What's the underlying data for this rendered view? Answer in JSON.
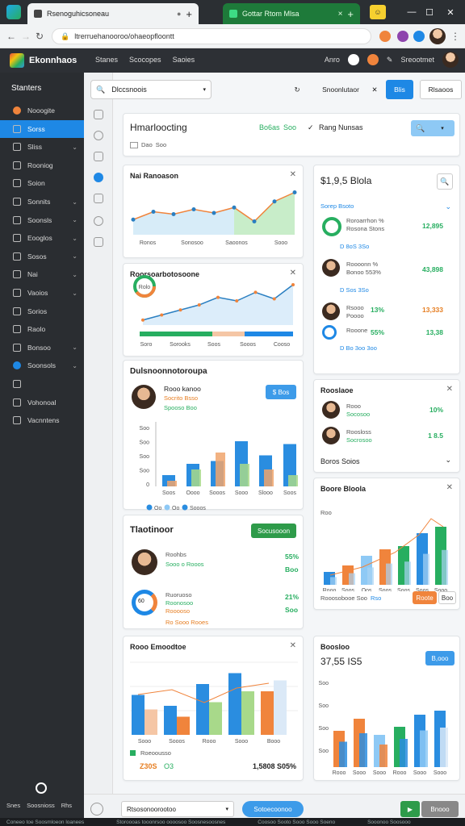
{
  "browser": {
    "tab1_title": "Rsenoguhicsoneau",
    "tab2_title": "Gottar Rtom Mlsa",
    "url": "ltrerruehanooroo/ohaeopfloontt",
    "win_controls": [
      "—",
      "☐",
      "✕"
    ]
  },
  "app": {
    "brand": "Ekonnhaos",
    "nav": [
      "Stanes",
      "Scocopes",
      "Saoies"
    ],
    "top_right": [
      "Anro",
      "Sreootmet"
    ]
  },
  "sidebar": {
    "title": "Stanters",
    "items": [
      {
        "label": "Nooogite",
        "chev": ""
      },
      {
        "label": "Sorss",
        "chev": ""
      },
      {
        "label": "Sliss",
        "chev": "⌄"
      },
      {
        "label": "Rooniog",
        "chev": ""
      },
      {
        "label": "Soion",
        "chev": ""
      },
      {
        "label": "Sonnits",
        "chev": "⌄"
      },
      {
        "label": "Soonsls",
        "chev": "⌄"
      },
      {
        "label": "Eooglos",
        "chev": "⌄"
      },
      {
        "label": "Sosos",
        "chev": "⌄"
      },
      {
        "label": "Nai",
        "chev": "⌄"
      },
      {
        "label": "Vaoios",
        "chev": "⌄"
      },
      {
        "label": "Sorios",
        "chev": ""
      },
      {
        "label": "Raolo",
        "chev": ""
      },
      {
        "label": "Bonsoo",
        "chev": "⌄"
      },
      {
        "label": "Soonsols",
        "chev": "⌄"
      },
      {
        "label": "",
        "chev": ""
      },
      {
        "label": "Vohonoal",
        "chev": ""
      },
      {
        "label": "Vacnntens",
        "chev": ""
      }
    ],
    "bottom": [
      "Snes",
      "Soosnioss",
      "Rhs"
    ]
  },
  "toolbar": {
    "search_text": "Dlccsnoois",
    "filter_label": "Snoonlutaor",
    "blue_btn": "Blis",
    "right_btn": "Rlsaoos"
  },
  "cards": {
    "header": {
      "title": "Hmarloocting",
      "green1": "Bo6as",
      "green2": "Soo",
      "link": "Rang Nunsas",
      "chip1": "Dao",
      "chip2": "Soo"
    },
    "line1": {
      "title": "Nai Ranoason",
      "ticks": [
        "Ronos",
        "Sonosoo",
        "Saoonos",
        "Sooo"
      ]
    },
    "line2": {
      "title": "Roorsoarbotosoone",
      "ticks": [
        "Soro",
        "Sorooks",
        "Soos",
        "Sooos",
        "Cooso"
      ],
      "donut": "Rolo"
    },
    "bars1": {
      "title": "Dulsnoonnotoroupa",
      "name": "Rooo kanoo",
      "sub1": "Socrito Bsso",
      "sub2": "Spooso Boo",
      "btn": "$ Bos",
      "y_ticks": [
        "Soo",
        "Soo",
        "Soo",
        "Soo",
        "0"
      ],
      "x_ticks": [
        "Soos",
        "Oooo",
        "Sooos",
        "Sooo",
        "Slooo",
        "Soos"
      ],
      "legend": [
        "Oo",
        "Oo",
        "Sooos"
      ]
    },
    "tasks": {
      "title": "Tlaotinoor",
      "btn": "Socusooon",
      "p1_name": "Roohbs",
      "p1_sub": "Sooo o Rooos",
      "p1_pct": "55%",
      "p1_val": "Boo",
      "p2_name": "Ruoruoso",
      "p2_sub1": "Roonosoo",
      "p2_sub2": "Rooooso",
      "p2_pct": "21%",
      "p2_val": "Soo",
      "ring": "60",
      "foot": "Ro Sooo Rooes"
    },
    "bars2": {
      "title": "Rooo Emoodtoe",
      "x_ticks": [
        "Sooo",
        "Sooos",
        "Rooo",
        "Sooo",
        "Booo"
      ],
      "foot_title": "Roeoousso",
      "foot_left": "Z30S",
      "foot_mid": "O3",
      "foot_right": "1,5808 S05%"
    },
    "stats": {
      "title": "$1,9,5 Blola",
      "subtitle": "Sorep Bsoto",
      "rows": [
        {
          "name": "Roroarrhon %",
          "sub": "Rosona Stons",
          "val": "12,895",
          "foot": "D 8oS 3So"
        },
        {
          "name": "Roooonn %",
          "sub": "Bonoo 553%",
          "val": "43,898",
          "foot": "D Sos 3So"
        },
        {
          "name": "Rsooo",
          "sub": "Poooo",
          "pct": "13%",
          "val": "13,333",
          "foot": ""
        },
        {
          "name": "Rooone",
          "sub": "",
          "pct": "55%",
          "val": "13,38",
          "foot": "D Bo 3oo 3oo"
        }
      ]
    },
    "team": {
      "title": "Rooslaoe",
      "r1_name": "Rooo",
      "r1_sub": "Socosoo",
      "r1_pct": "10%",
      "r2_name": "Roosloss",
      "r2_sub": "Socrosoo",
      "r2_val": "1 8.5",
      "foot": "Boros Soios"
    },
    "bars3": {
      "title": "Boore Bloola",
      "y_label": "Roo",
      "x_ticks": [
        "Rooo",
        "Soos",
        "Oos",
        "Soos",
        "Soos",
        "Soos",
        "Sooo"
      ],
      "foot_left": "Rooosobooe Soo",
      "foot_mid": "Rso",
      "btn1": "Roote",
      "btn2": "Boo"
    },
    "bars4": {
      "title": "Boosloo",
      "value": "37,55 IS5",
      "btn": "B,ooo",
      "y_ticks": [
        "Soo",
        "Soo",
        "Soo",
        "Soo"
      ],
      "x_ticks": [
        "Rooo",
        "Sooo",
        "Sooo",
        "Rooo",
        "Sooo",
        "Sooo"
      ]
    }
  },
  "bottom": {
    "input": "Rtsosonoorootoo",
    "btn": "Sotoecoonoo",
    "go": "Bnooo"
  },
  "status": [
    "Coneeo toe Soosmloeon loanees",
    "Storoooas tooonrsoo oooosoo Soosnesoosnes",
    "Coosoo Sooto Sooo Sooo Soeno",
    "Sooonoo Soosooo"
  ],
  "chart_data": [
    {
      "type": "area",
      "title": "Nai Ranoason",
      "series": [
        {
          "values": [
            25,
            38,
            34,
            42,
            36,
            45,
            22,
            55,
            70
          ]
        }
      ]
    },
    {
      "type": "line",
      "title": "Roorsoarbotosoone",
      "series": [
        {
          "values": [
            10,
            20,
            30,
            40,
            55,
            48,
            65,
            52,
            80
          ]
        }
      ]
    },
    {
      "type": "bar",
      "title": "Dulsnoonnotoroupa",
      "categories": [
        "Soos",
        "Oooo",
        "Sooos",
        "Sooo",
        "Slooo",
        "Soos"
      ],
      "series": [
        {
          "values": [
            20,
            40,
            45,
            80,
            55,
            75
          ]
        },
        {
          "values": [
            10,
            30,
            60,
            40,
            30,
            20
          ]
        }
      ]
    },
    {
      "type": "bar",
      "title": "Rooo Emoodtoe",
      "categories": [
        "Sooo",
        "Sooos",
        "Rooo",
        "Sooo",
        "Booo"
      ],
      "series": [
        {
          "values": [
            55,
            40,
            70,
            85,
            60
          ]
        },
        {
          "values": [
            35,
            25,
            45,
            60,
            75
          ]
        }
      ]
    },
    {
      "type": "bar",
      "title": "Boore Bloola",
      "categories": [
        "Rooo",
        "Soos",
        "Oos",
        "Soos",
        "Soos",
        "Soos",
        "Sooo"
      ],
      "series": [
        {
          "values": [
            20,
            30,
            45,
            55,
            60,
            80,
            90
          ]
        }
      ]
    },
    {
      "type": "bar",
      "title": "Boosloo",
      "categories": [
        "Rooo",
        "Sooo",
        "Sooo",
        "Rooo",
        "Sooo",
        "Sooo"
      ],
      "series": [
        {
          "values": [
            45,
            60,
            40,
            50,
            65,
            70
          ]
        }
      ]
    }
  ],
  "colors": {
    "accent": "#1e88e5",
    "green": "#27ae60",
    "orange": "#f0843c",
    "sidebar": "#2a2d31"
  }
}
